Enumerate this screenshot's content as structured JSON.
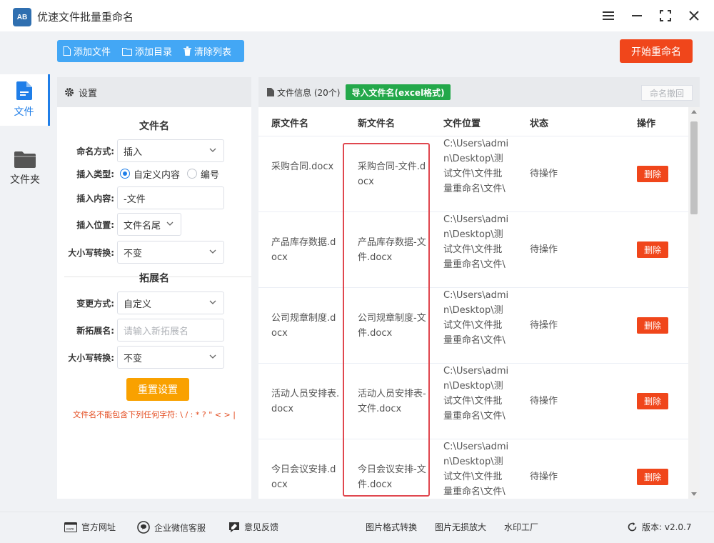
{
  "app": {
    "title": "优速文件批量重命名",
    "logo_text": "AB"
  },
  "window_controls": {
    "menu": "menu-icon",
    "minimize": "minimize-icon",
    "maximize": "maximize-icon",
    "close": "close-icon"
  },
  "nav": [
    {
      "label": "文件",
      "icon": "file-icon",
      "active": true
    },
    {
      "label": "文件夹",
      "icon": "folder-icon",
      "active": false
    }
  ],
  "toolbar": {
    "add_file": "添加文件",
    "add_dir": "添加目录",
    "clear_list": "清除列表",
    "start": "开始重命名"
  },
  "settings": {
    "header": "设置",
    "filename_section": "文件名",
    "naming_mode_label": "命名方式:",
    "naming_mode_value": "插入",
    "insert_type_label": "插入类型:",
    "insert_type_opt1": "自定义内容",
    "insert_type_opt2": "编号",
    "insert_content_label": "插入内容:",
    "insert_content_value": "-文件",
    "insert_pos_label": "插入位置:",
    "insert_pos_value": "文件名尾",
    "case_label": "大小写转换:",
    "case_value": "不变",
    "ext_section": "拓展名",
    "change_mode_label": "变更方式:",
    "change_mode_value": "自定义",
    "new_ext_label": "新拓展名:",
    "new_ext_placeholder": "请输入新拓展名",
    "ext_case_label": "大小写转换:",
    "ext_case_value": "不变",
    "reset": "重置设置",
    "warning": "文件名不能包含下列任何字符: \\ / : * ? \" < > |"
  },
  "files": {
    "header": "文件信息 (20个)",
    "import": "导入文件名(excel格式)",
    "undo": "命名撤回",
    "columns": [
      "原文件名",
      "新文件名",
      "文件位置",
      "状态",
      "操作"
    ],
    "rows": [
      {
        "orig": "采购合同.docx",
        "new": "采购合同-文件.docx",
        "path": "C:\\Users\\admin\\Desktop\\测试文件\\文件批量重命名\\文件\\",
        "status": "待操作",
        "action": "删除"
      },
      {
        "orig": "产品库存数据.docx",
        "new": "产品库存数据-文件.docx",
        "path": "C:\\Users\\admin\\Desktop\\测试文件\\文件批量重命名\\文件\\",
        "status": "待操作",
        "action": "删除"
      },
      {
        "orig": "公司规章制度.docx",
        "new": "公司规章制度-文件.docx",
        "path": "C:\\Users\\admin\\Desktop\\测试文件\\文件批量重命名\\文件\\",
        "status": "待操作",
        "action": "删除"
      },
      {
        "orig": "活动人员安排表.docx",
        "new": "活动人员安排表-文件.docx",
        "path": "C:\\Users\\admin\\Desktop\\测试文件\\文件批量重命名\\文件\\",
        "status": "待操作",
        "action": "删除"
      },
      {
        "orig": "今日会议安排.docx",
        "new": "今日会议安排-文件.docx",
        "path": "C:\\Users\\admin\\Desktop\\测试文件\\文件批量重命名\\文件\\",
        "status": "待操作",
        "action": "删除"
      }
    ]
  },
  "footer": {
    "website": "官方网址",
    "wechat": "企业微信客服",
    "feedback": "意见反馈",
    "img_convert": "图片格式转换",
    "img_enlarge": "图片无损放大",
    "watermark": "水印工厂",
    "version": "版本: v2.0.7"
  },
  "colors": {
    "primary": "#1f7ee8",
    "toolbar": "#43a7f5",
    "danger": "#f0461b",
    "import": "#23a84a",
    "reset": "#f9a100",
    "highlight": "#e0474f"
  }
}
